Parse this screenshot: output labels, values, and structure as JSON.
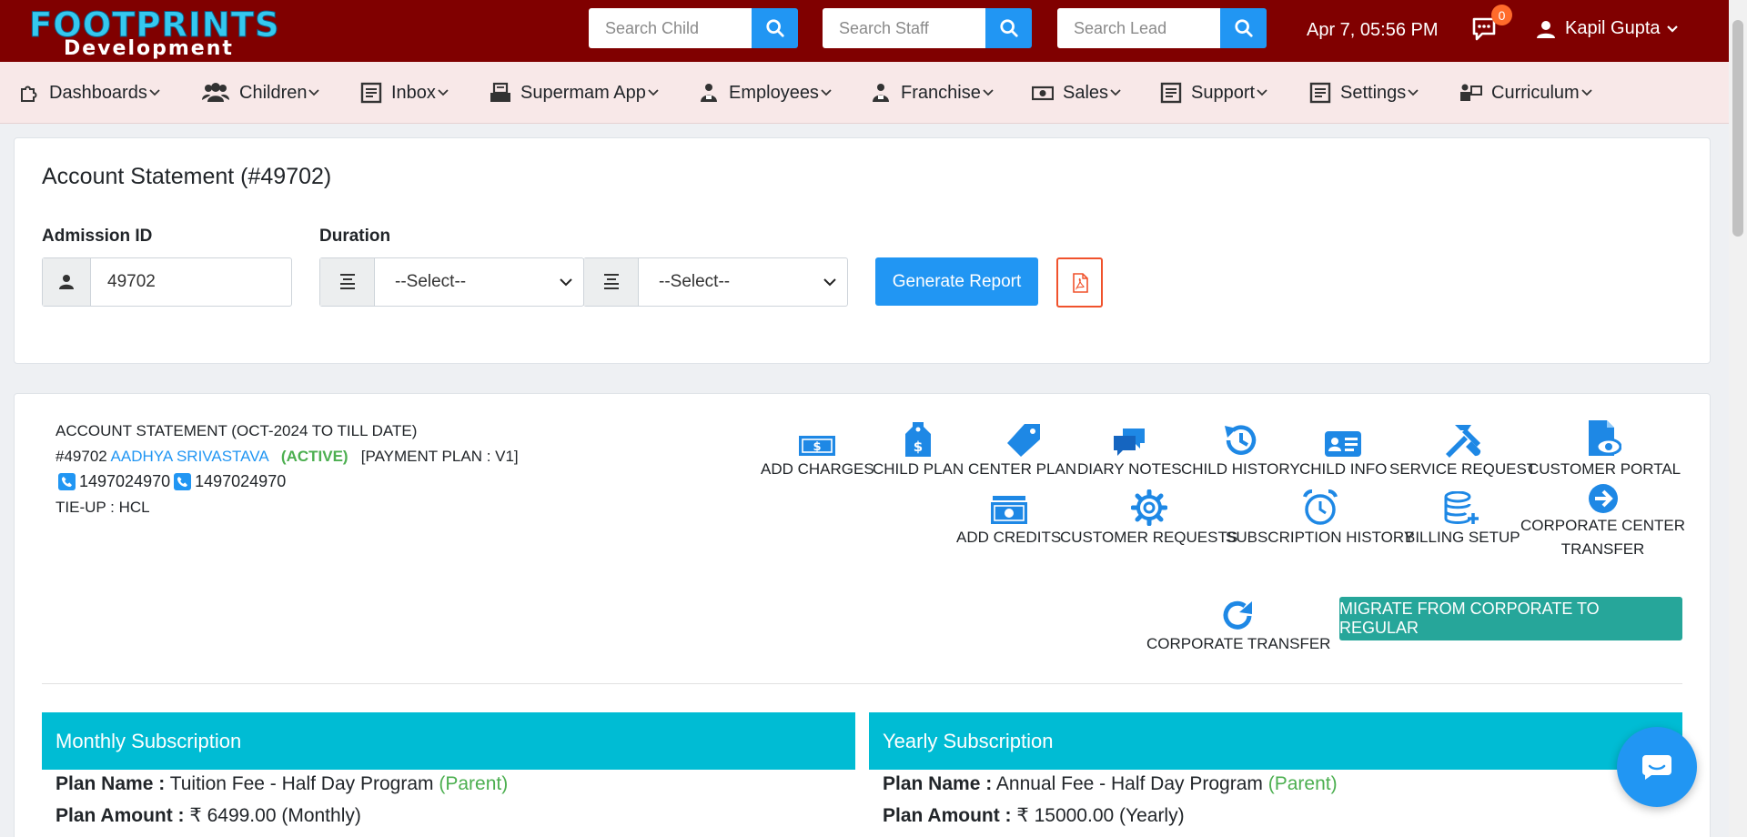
{
  "header": {
    "logo_main": "FOOTPRINTS",
    "logo_sub": "Development",
    "search_child_placeholder": "Search Child",
    "search_staff_placeholder": "Search Staff",
    "search_lead_placeholder": "Search Lead",
    "datetime": "Apr 7, 05:56 PM",
    "notification_count": "0",
    "user_name": "Kapil Gupta"
  },
  "nav": [
    {
      "label": "Dashboards",
      "icon": "puzzle-icon"
    },
    {
      "label": "Children",
      "icon": "users-icon"
    },
    {
      "label": "Inbox",
      "icon": "inbox-icon"
    },
    {
      "label": "Supermam App",
      "icon": "printer-icon"
    },
    {
      "label": "Employees",
      "icon": "employee-icon"
    },
    {
      "label": "Franchise",
      "icon": "franchise-icon"
    },
    {
      "label": "Sales",
      "icon": "money-icon"
    },
    {
      "label": "Support",
      "icon": "support-icon"
    },
    {
      "label": "Settings",
      "icon": "settings-icon"
    },
    {
      "label": "Curriculum",
      "icon": "curriculum-icon"
    }
  ],
  "filter": {
    "page_title": "Account Statement (#49702)",
    "admission_label": "Admission ID",
    "admission_value": "49702",
    "duration_label": "Duration",
    "duration_from": "--Select--",
    "duration_to": "--Select--",
    "generate_label": "Generate Report"
  },
  "statement": {
    "title": "ACCOUNT STATEMENT (OCT-2024 TO TILL DATE)",
    "id": "#49702",
    "child_name": "AADHYA SRIVASTAVA",
    "status": "(ACTIVE)",
    "payment_plan": "[PAYMENT PLAN : V1]",
    "phone1": "1497024970",
    "phone2": "1497024970",
    "tieup": "TIE-UP : HCL"
  },
  "actions": {
    "add_charges": "ADD CHARGES",
    "child_plan": "CHILD PLAN",
    "center_plan": "CENTER PLAN",
    "diary_notes": "DIARY NOTES",
    "child_history": "CHILD HISTORY",
    "child_info": "CHILD INFO",
    "service_request": "SERVICE REQUEST",
    "customer_portal": "CUSTOMER PORTAL",
    "add_credits": "ADD CREDITS",
    "customer_requests": "CUSTOMER REQUESTS",
    "subscription_history": "SUBSCRIPTION HISTORY",
    "billing_setup": "BILLING SETUP",
    "corporate_center_transfer_1": "CORPORATE CENTER",
    "corporate_center_transfer_2": "TRANSFER",
    "corporate_transfer": "CORPORATE TRANSFER",
    "migrate": "MIGRATE FROM CORPORATE TO REGULAR"
  },
  "monthly": {
    "heading": "Monthly Subscription",
    "plan_name_label": "Plan Name :",
    "plan_name": "Tuition Fee - Half Day Program",
    "plan_tag": "(Parent)",
    "plan_amount_label": "Plan Amount :",
    "plan_amount": "₹ 6499.00 (Monthly)"
  },
  "yearly": {
    "heading": "Yearly Subscription",
    "plan_name_label": "Plan Name :",
    "plan_name": "Annual Fee - Half Day Program",
    "plan_tag": "(Parent)",
    "plan_amount_label": "Plan Amount :",
    "plan_amount": "₹ 15000.00 (Yearly)"
  },
  "colors": {
    "topbar": "#800000",
    "accent": "#2196f3",
    "teal": "#26a69a",
    "cyan": "#00bcd4",
    "active": "#4caf50"
  }
}
